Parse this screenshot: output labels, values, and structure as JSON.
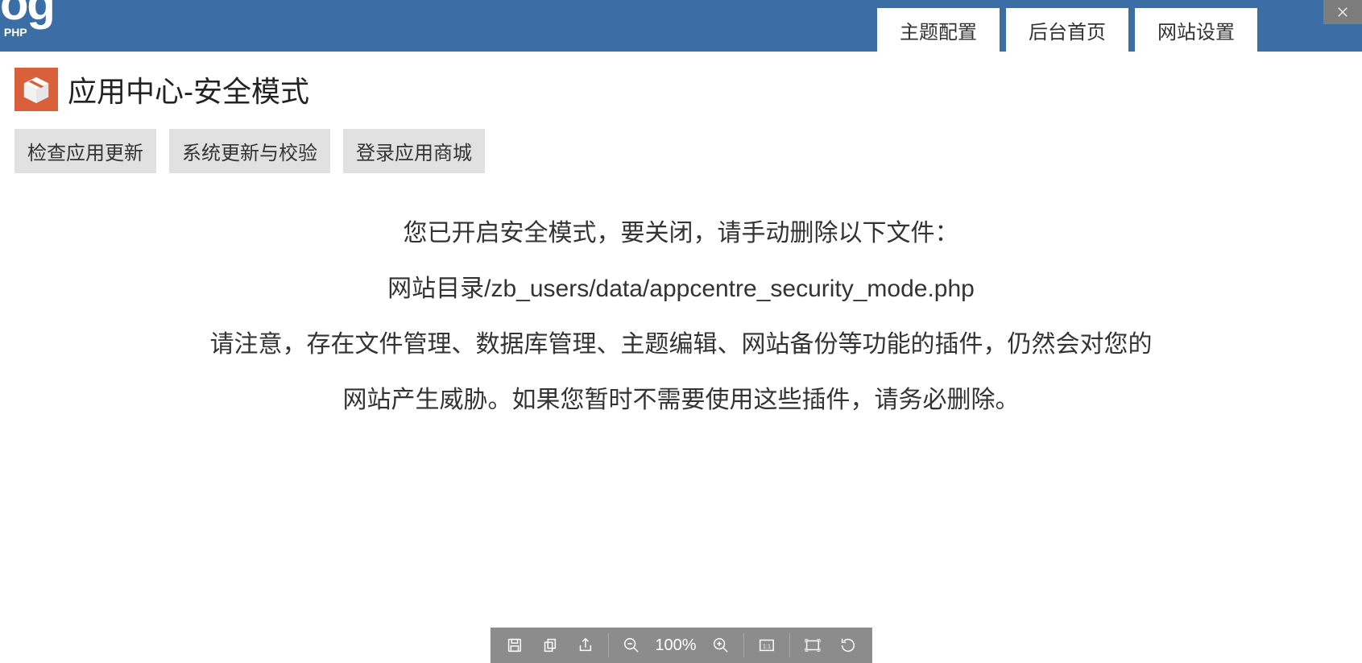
{
  "header": {
    "logo_main": "og",
    "logo_sub": "PHP",
    "tabs": [
      {
        "label": "主题配置"
      },
      {
        "label": "后台首页"
      },
      {
        "label": "网站设置"
      }
    ]
  },
  "page": {
    "title": "应用中心-安全模式",
    "buttons": [
      {
        "label": "检查应用更新"
      },
      {
        "label": "系统更新与校验"
      },
      {
        "label": "登录应用商城"
      }
    ],
    "message_line1": "您已开启安全模式，要关闭，请手动删除以下文件：",
    "message_line2": "网站目录/zb_users/data/appcentre_security_mode.php",
    "message_line3": "请注意，存在文件管理、数据库管理、主题编辑、网站备份等功能的插件，仍然会对您的网站产生威胁。如果您暂时不需要使用这些插件，请务必删除。"
  },
  "viewer": {
    "zoom": "100%"
  }
}
